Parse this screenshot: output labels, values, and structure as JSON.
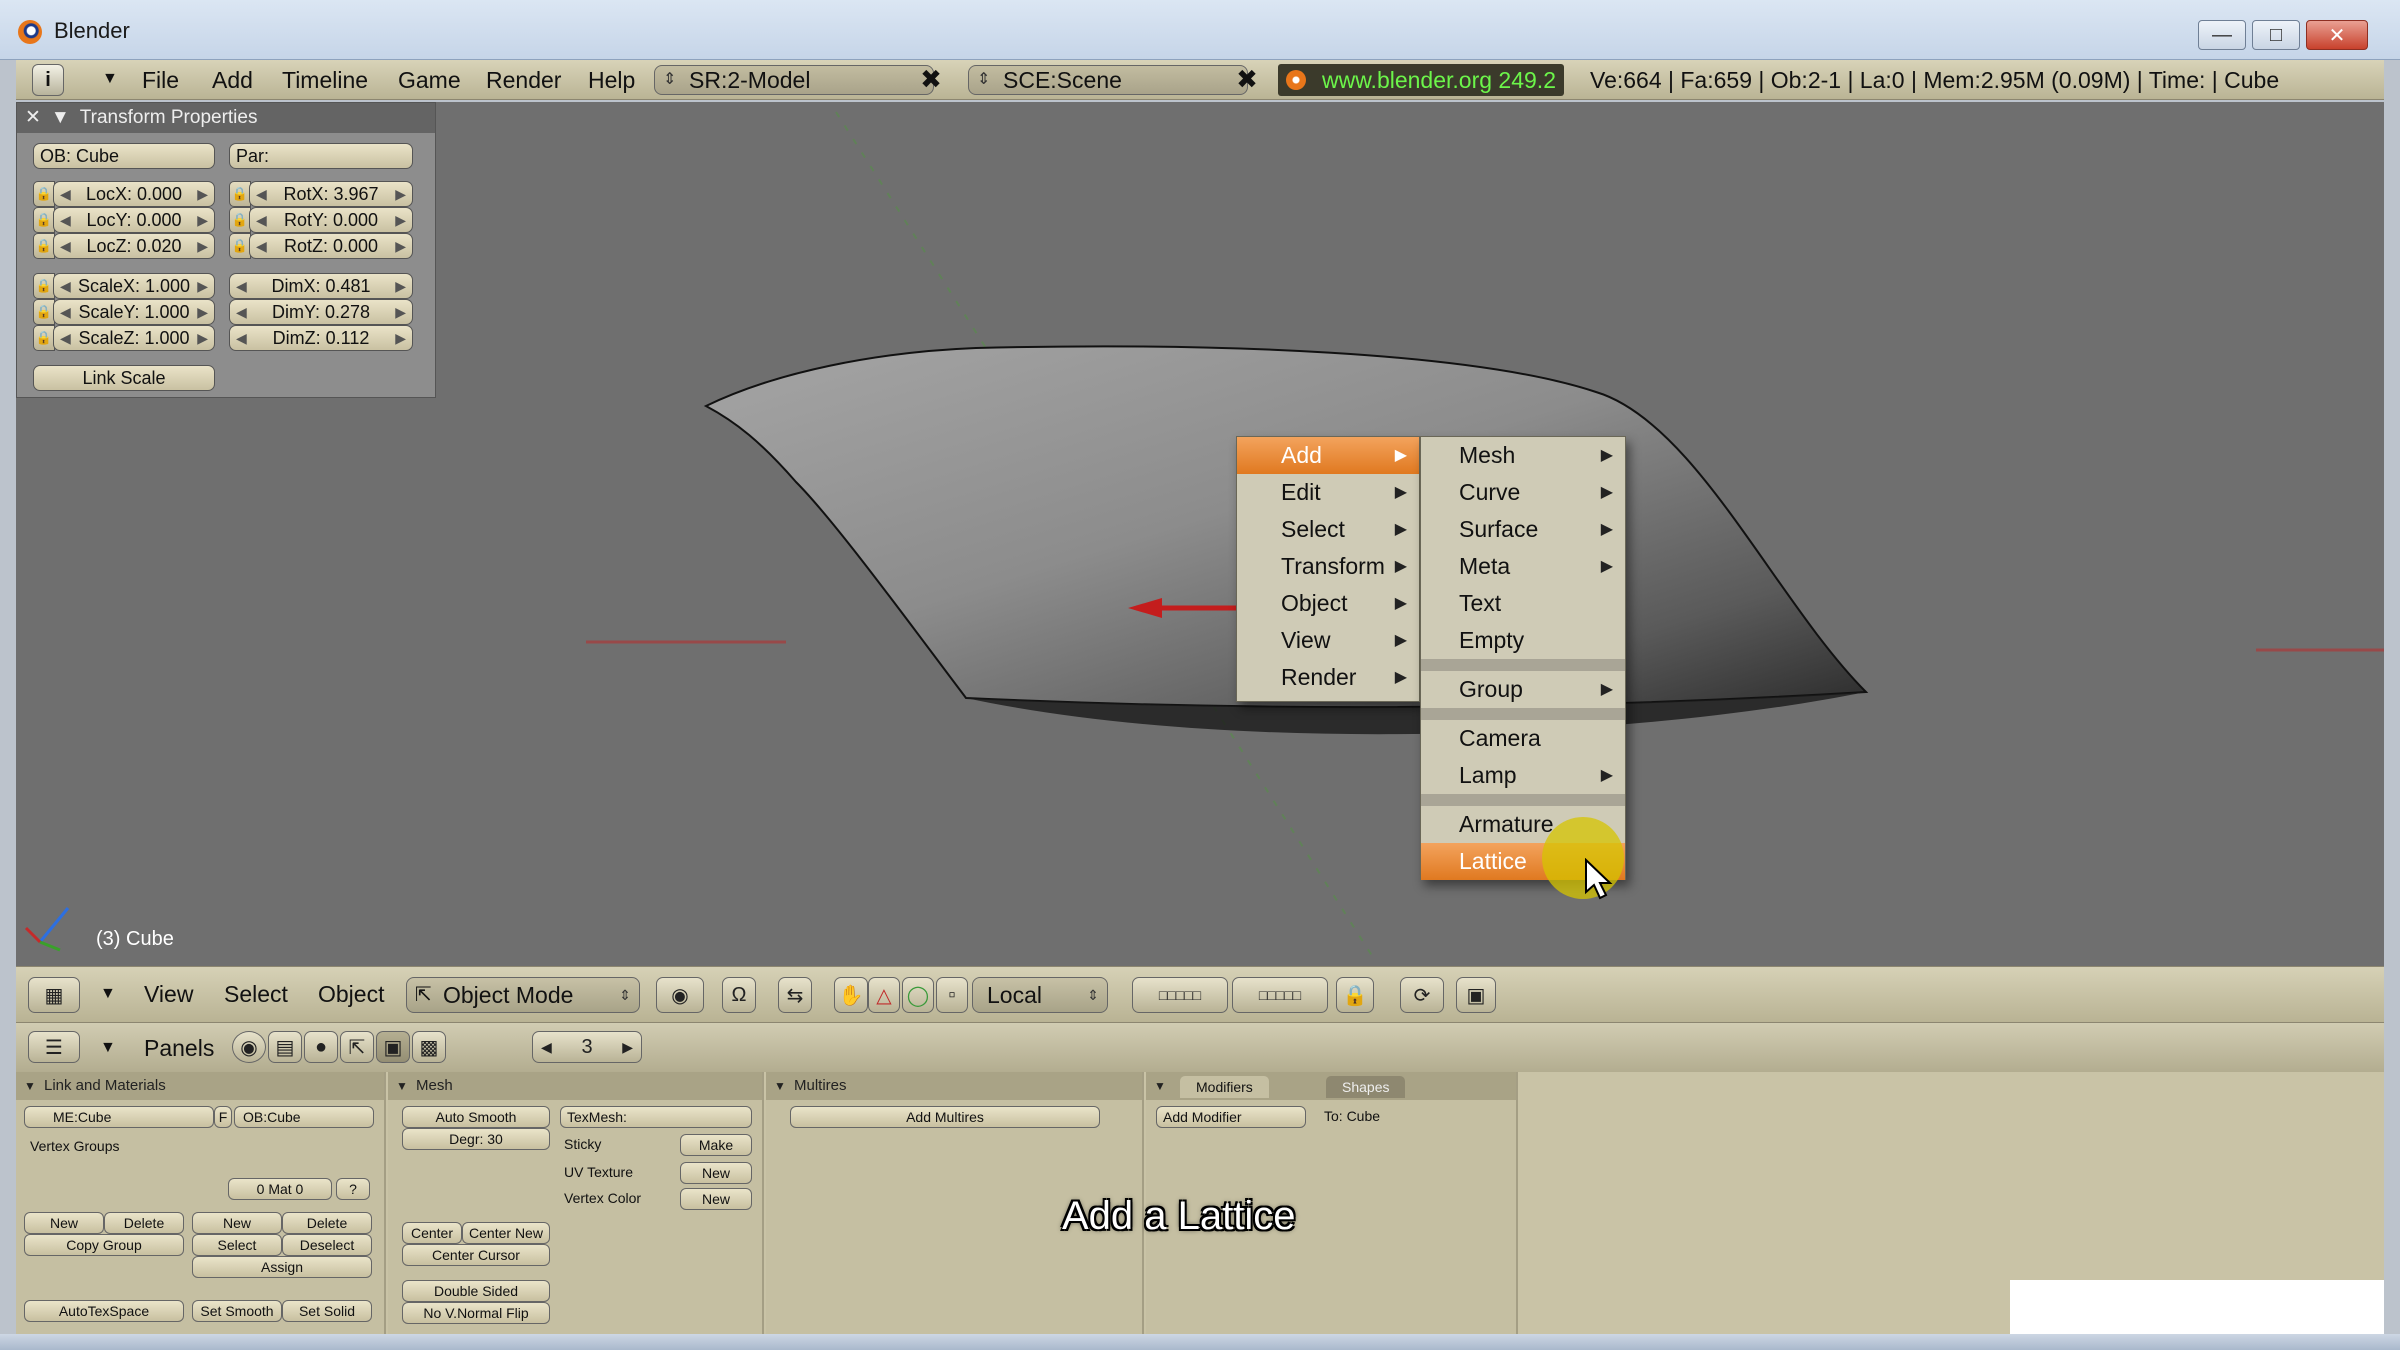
{
  "window": {
    "title": "Blender",
    "controls": [
      "minimize-icon",
      "maximize-icon",
      "close-icon"
    ]
  },
  "mainbar": {
    "menus": [
      "File",
      "Add",
      "Timeline",
      "Game",
      "Render",
      "Help"
    ],
    "screen": "SR:2-Model",
    "scene": "SCE:Scene",
    "link": "www.blender.org 249.2",
    "stats": "Ve:664 | Fa:659 | Ob:2-1 | La:0 | Mem:2.95M (0.09M) | Time: | Cube"
  },
  "transform_panel": {
    "title": "Transform Properties",
    "ob": "OB: Cube",
    "par": "Par:",
    "loc": [
      "LocX: 0.000",
      "LocY: 0.000",
      "LocZ: 0.020"
    ],
    "rot": [
      "RotX: 3.967",
      "RotY: 0.000",
      "RotZ: 0.000"
    ],
    "scale": [
      "ScaleX: 1.000",
      "ScaleY: 1.000",
      "ScaleZ: 1.000"
    ],
    "dim": [
      "DimX: 0.481",
      "DimY: 0.278",
      "DimZ: 0.112"
    ],
    "link_scale": "Link Scale"
  },
  "viewport": {
    "object_label": "(3) Cube"
  },
  "context_menu": {
    "items": [
      "Add",
      "Edit",
      "Select",
      "Transform",
      "Object",
      "View",
      "Render"
    ],
    "highlighted": "Add"
  },
  "add_submenu": {
    "group1": [
      "Mesh",
      "Curve",
      "Surface",
      "Meta",
      "Text",
      "Empty"
    ],
    "group2": [
      "Group"
    ],
    "group3": [
      "Camera",
      "Lamp"
    ],
    "group4": [
      "Armature",
      "Lattice"
    ],
    "highlighted": "Lattice"
  },
  "view_header": {
    "menus": [
      "View",
      "Select",
      "Object"
    ],
    "mode": "Object Mode",
    "orientation": "Local"
  },
  "buttons_header": {
    "panels_label": "Panels",
    "frame": "3"
  },
  "link_materials": {
    "title": "Link and Materials",
    "me": "ME:Cube",
    "f": "F",
    "ob": "OB:Cube",
    "vertex_groups": "Vertex Groups",
    "mat": "0 Mat 0",
    "q": "?",
    "new": "New",
    "delete": "Delete",
    "copy_group": "Copy Group",
    "new2": "New",
    "delete2": "Delete",
    "select": "Select",
    "deselect": "Deselect",
    "assign": "Assign",
    "autotexspace": "AutoTexSpace",
    "set_smooth": "Set Smooth",
    "set_solid": "Set Solid"
  },
  "mesh_panel": {
    "title": "Mesh",
    "auto_smooth": "Auto Smooth",
    "degr": "Degr: 30",
    "texmesh": "TexMesh:",
    "sticky": "Sticky",
    "make": "Make",
    "uv_texture": "UV Texture",
    "new_uv": "New",
    "vertex_color": "Vertex Color",
    "new_vc": "New",
    "center": "Center",
    "center_new": "Center New",
    "center_cursor": "Center Cursor",
    "double_sided": "Double Sided",
    "no_vnormal_flip": "No V.Normal Flip"
  },
  "multires_panel": {
    "title": "Multires",
    "add_multires": "Add Multires"
  },
  "modifiers_panel": {
    "tab_modifiers": "Modifiers",
    "tab_shapes": "Shapes",
    "add_modifier": "Add Modifier",
    "to": "To: Cube"
  },
  "caption": "Add a Lattice",
  "colors": {
    "highlight": "#e8862f",
    "link_green": "#6cf54a",
    "viewport_bg": "#6f6f6f",
    "cursor_halo": "#d6c400"
  }
}
